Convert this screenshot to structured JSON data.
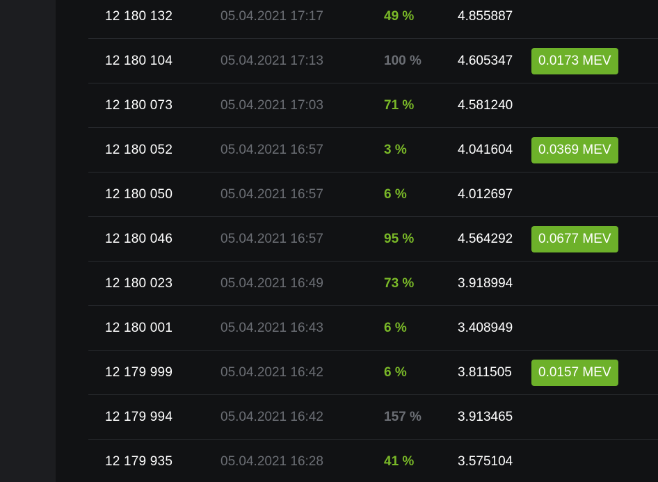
{
  "rows": [
    {
      "block": "12 180 132",
      "time": "05.04.2021 17:17",
      "percent": "49 %",
      "percent_color": "#7ab928",
      "fee": "4.855887",
      "mev": ""
    },
    {
      "block": "12 180 104",
      "time": "05.04.2021 17:13",
      "percent": "100 %",
      "percent_color": "#6b6e74",
      "fee": "4.605347",
      "mev": "0.0173 MEV"
    },
    {
      "block": "12 180 073",
      "time": "05.04.2021 17:03",
      "percent": "71 %",
      "percent_color": "#7ab928",
      "fee": "4.581240",
      "mev": ""
    },
    {
      "block": "12 180 052",
      "time": "05.04.2021 16:57",
      "percent": "3 %",
      "percent_color": "#7ab928",
      "fee": "4.041604",
      "mev": "0.0369 MEV"
    },
    {
      "block": "12 180 050",
      "time": "05.04.2021 16:57",
      "percent": "6 %",
      "percent_color": "#7ab928",
      "fee": "4.012697",
      "mev": ""
    },
    {
      "block": "12 180 046",
      "time": "05.04.2021 16:57",
      "percent": "95 %",
      "percent_color": "#7ab928",
      "fee": "4.564292",
      "mev": "0.0677 MEV"
    },
    {
      "block": "12 180 023",
      "time": "05.04.2021 16:49",
      "percent": "73 %",
      "percent_color": "#7ab928",
      "fee": "3.918994",
      "mev": ""
    },
    {
      "block": "12 180 001",
      "time": "05.04.2021 16:43",
      "percent": "6 %",
      "percent_color": "#7ab928",
      "fee": "3.408949",
      "mev": ""
    },
    {
      "block": "12 179 999",
      "time": "05.04.2021 16:42",
      "percent": "6 %",
      "percent_color": "#7ab928",
      "fee": "3.811505",
      "mev": "0.0157 MEV"
    },
    {
      "block": "12 179 994",
      "time": "05.04.2021 16:42",
      "percent": "157 %",
      "percent_color": "#6b6e74",
      "fee": "3.913465",
      "mev": ""
    },
    {
      "block": "12 179 935",
      "time": "05.04.2021 16:28",
      "percent": "41 %",
      "percent_color": "#7ab928",
      "fee": "3.575104",
      "mev": ""
    }
  ],
  "colors": {
    "background": "#111214",
    "side_panel": "#1c1d20",
    "accent_green": "#6db12a",
    "muted_text": "#6b6e74"
  }
}
